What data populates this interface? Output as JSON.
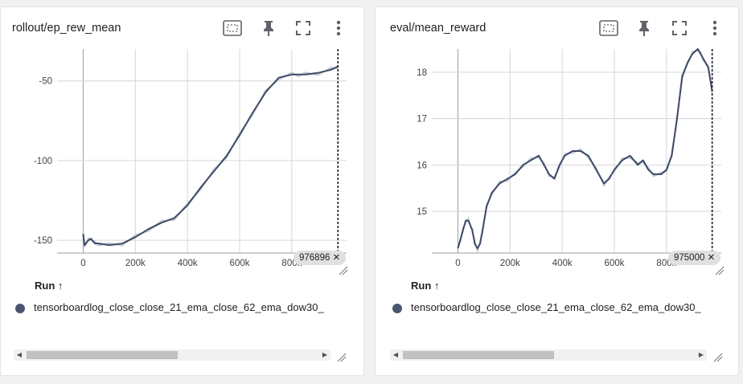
{
  "cards": [
    {
      "title": "rollout/ep_rew_mean",
      "end_step_label": "976896",
      "run_header": "Run",
      "run_sort_icon": "↑",
      "run_name": "tensorboardlog_close_close_21_ema_close_62_ema_dow30_",
      "run_color": "#4a5573"
    },
    {
      "title": "eval/mean_reward",
      "end_step_label": "975000",
      "run_header": "Run",
      "run_sort_icon": "↑",
      "run_name": "tensorboardlog_close_close_21_ema_close_62_ema_dow30_",
      "run_color": "#4a5573"
    }
  ],
  "icons": [
    "fit-domain-icon",
    "pin-icon",
    "fullscreen-icon",
    "more-vert-icon"
  ],
  "colors": {
    "line": "#3d4a66",
    "raw": "#c3c9d6",
    "grid": "#d6d6d6",
    "axis": "#9e9e9e"
  },
  "chart_data": [
    {
      "type": "line",
      "title": "rollout/ep_rew_mean",
      "x_ticks": [
        "0",
        "200k",
        "400k",
        "600k",
        "800k"
      ],
      "y_ticks": [
        "-50",
        "-100",
        "-150"
      ],
      "xlim": [
        -100000,
        1010000
      ],
      "ylim": [
        -158,
        -30
      ],
      "grid": true,
      "series": [
        {
          "x": [
            0,
            5000,
            20000,
            30000,
            45000,
            60000,
            100000,
            150000,
            200000,
            250000,
            300000,
            350000,
            400000,
            450000,
            500000,
            550000,
            600000,
            650000,
            700000,
            750000,
            800000,
            825000,
            850000,
            900000,
            950000,
            976896
          ],
          "y": [
            -146,
            -153,
            -150,
            -149,
            -152,
            -152,
            -153,
            -152,
            -148,
            -143,
            -139,
            -136,
            -128,
            -117,
            -107,
            -97,
            -84,
            -70,
            -57,
            -48,
            -46,
            -46,
            -46,
            -45,
            -43,
            -41
          ]
        }
      ]
    },
    {
      "type": "line",
      "title": "eval/mean_reward",
      "x_ticks": [
        "0",
        "200k",
        "400k",
        "600k",
        "800k"
      ],
      "y_ticks": [
        "18",
        "17",
        "16",
        "15"
      ],
      "xlim": [
        -100000,
        1010000
      ],
      "ylim": [
        14.1,
        18.5
      ],
      "grid": true,
      "series": [
        {
          "x": [
            0,
            10000,
            20000,
            30000,
            40000,
            55000,
            65000,
            75000,
            85000,
            95000,
            110000,
            130000,
            160000,
            190000,
            220000,
            250000,
            280000,
            310000,
            330000,
            350000,
            370000,
            390000,
            410000,
            440000,
            470000,
            500000,
            530000,
            560000,
            580000,
            600000,
            630000,
            660000,
            690000,
            710000,
            730000,
            750000,
            780000,
            800000,
            820000,
            840000,
            860000,
            880000,
            900000,
            920000,
            930000,
            940000,
            960000,
            975000
          ],
          "y": [
            14.2,
            14.4,
            14.6,
            14.8,
            14.8,
            14.6,
            14.3,
            14.2,
            14.3,
            14.6,
            15.1,
            15.4,
            15.6,
            15.7,
            15.8,
            16.0,
            16.1,
            16.2,
            16.0,
            15.8,
            15.7,
            16.0,
            16.2,
            16.3,
            16.3,
            16.2,
            15.9,
            15.6,
            15.7,
            15.9,
            16.1,
            16.2,
            16.0,
            16.1,
            15.9,
            15.8,
            15.8,
            15.9,
            16.2,
            17.0,
            17.9,
            18.2,
            18.4,
            18.5,
            18.4,
            18.3,
            18.1,
            17.6
          ]
        }
      ]
    }
  ]
}
